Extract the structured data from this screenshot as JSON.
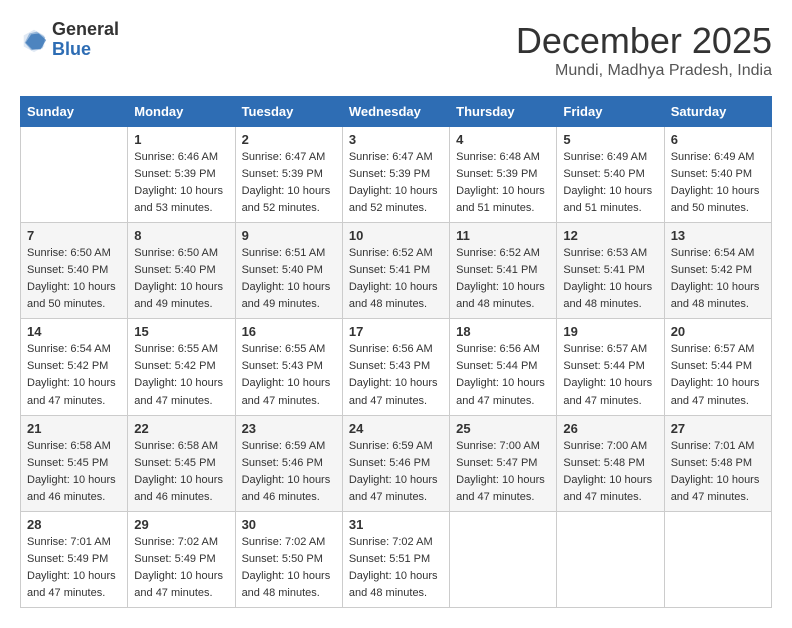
{
  "header": {
    "logo_general": "General",
    "logo_blue": "Blue",
    "title": "December 2025",
    "location": "Mundi, Madhya Pradesh, India"
  },
  "calendar": {
    "days_of_week": [
      "Sunday",
      "Monday",
      "Tuesday",
      "Wednesday",
      "Thursday",
      "Friday",
      "Saturday"
    ],
    "weeks": [
      [
        {
          "day": "",
          "info": ""
        },
        {
          "day": "1",
          "info": "Sunrise: 6:46 AM\nSunset: 5:39 PM\nDaylight: 10 hours\nand 53 minutes."
        },
        {
          "day": "2",
          "info": "Sunrise: 6:47 AM\nSunset: 5:39 PM\nDaylight: 10 hours\nand 52 minutes."
        },
        {
          "day": "3",
          "info": "Sunrise: 6:47 AM\nSunset: 5:39 PM\nDaylight: 10 hours\nand 52 minutes."
        },
        {
          "day": "4",
          "info": "Sunrise: 6:48 AM\nSunset: 5:39 PM\nDaylight: 10 hours\nand 51 minutes."
        },
        {
          "day": "5",
          "info": "Sunrise: 6:49 AM\nSunset: 5:40 PM\nDaylight: 10 hours\nand 51 minutes."
        },
        {
          "day": "6",
          "info": "Sunrise: 6:49 AM\nSunset: 5:40 PM\nDaylight: 10 hours\nand 50 minutes."
        }
      ],
      [
        {
          "day": "7",
          "info": "Sunrise: 6:50 AM\nSunset: 5:40 PM\nDaylight: 10 hours\nand 50 minutes."
        },
        {
          "day": "8",
          "info": "Sunrise: 6:50 AM\nSunset: 5:40 PM\nDaylight: 10 hours\nand 49 minutes."
        },
        {
          "day": "9",
          "info": "Sunrise: 6:51 AM\nSunset: 5:40 PM\nDaylight: 10 hours\nand 49 minutes."
        },
        {
          "day": "10",
          "info": "Sunrise: 6:52 AM\nSunset: 5:41 PM\nDaylight: 10 hours\nand 48 minutes."
        },
        {
          "day": "11",
          "info": "Sunrise: 6:52 AM\nSunset: 5:41 PM\nDaylight: 10 hours\nand 48 minutes."
        },
        {
          "day": "12",
          "info": "Sunrise: 6:53 AM\nSunset: 5:41 PM\nDaylight: 10 hours\nand 48 minutes."
        },
        {
          "day": "13",
          "info": "Sunrise: 6:54 AM\nSunset: 5:42 PM\nDaylight: 10 hours\nand 48 minutes."
        }
      ],
      [
        {
          "day": "14",
          "info": "Sunrise: 6:54 AM\nSunset: 5:42 PM\nDaylight: 10 hours\nand 47 minutes."
        },
        {
          "day": "15",
          "info": "Sunrise: 6:55 AM\nSunset: 5:42 PM\nDaylight: 10 hours\nand 47 minutes."
        },
        {
          "day": "16",
          "info": "Sunrise: 6:55 AM\nSunset: 5:43 PM\nDaylight: 10 hours\nand 47 minutes."
        },
        {
          "day": "17",
          "info": "Sunrise: 6:56 AM\nSunset: 5:43 PM\nDaylight: 10 hours\nand 47 minutes."
        },
        {
          "day": "18",
          "info": "Sunrise: 6:56 AM\nSunset: 5:44 PM\nDaylight: 10 hours\nand 47 minutes."
        },
        {
          "day": "19",
          "info": "Sunrise: 6:57 AM\nSunset: 5:44 PM\nDaylight: 10 hours\nand 47 minutes."
        },
        {
          "day": "20",
          "info": "Sunrise: 6:57 AM\nSunset: 5:44 PM\nDaylight: 10 hours\nand 47 minutes."
        }
      ],
      [
        {
          "day": "21",
          "info": "Sunrise: 6:58 AM\nSunset: 5:45 PM\nDaylight: 10 hours\nand 46 minutes."
        },
        {
          "day": "22",
          "info": "Sunrise: 6:58 AM\nSunset: 5:45 PM\nDaylight: 10 hours\nand 46 minutes."
        },
        {
          "day": "23",
          "info": "Sunrise: 6:59 AM\nSunset: 5:46 PM\nDaylight: 10 hours\nand 46 minutes."
        },
        {
          "day": "24",
          "info": "Sunrise: 6:59 AM\nSunset: 5:46 PM\nDaylight: 10 hours\nand 47 minutes."
        },
        {
          "day": "25",
          "info": "Sunrise: 7:00 AM\nSunset: 5:47 PM\nDaylight: 10 hours\nand 47 minutes."
        },
        {
          "day": "26",
          "info": "Sunrise: 7:00 AM\nSunset: 5:48 PM\nDaylight: 10 hours\nand 47 minutes."
        },
        {
          "day": "27",
          "info": "Sunrise: 7:01 AM\nSunset: 5:48 PM\nDaylight: 10 hours\nand 47 minutes."
        }
      ],
      [
        {
          "day": "28",
          "info": "Sunrise: 7:01 AM\nSunset: 5:49 PM\nDaylight: 10 hours\nand 47 minutes."
        },
        {
          "day": "29",
          "info": "Sunrise: 7:02 AM\nSunset: 5:49 PM\nDaylight: 10 hours\nand 47 minutes."
        },
        {
          "day": "30",
          "info": "Sunrise: 7:02 AM\nSunset: 5:50 PM\nDaylight: 10 hours\nand 48 minutes."
        },
        {
          "day": "31",
          "info": "Sunrise: 7:02 AM\nSunset: 5:51 PM\nDaylight: 10 hours\nand 48 minutes."
        },
        {
          "day": "",
          "info": ""
        },
        {
          "day": "",
          "info": ""
        },
        {
          "day": "",
          "info": ""
        }
      ]
    ]
  }
}
